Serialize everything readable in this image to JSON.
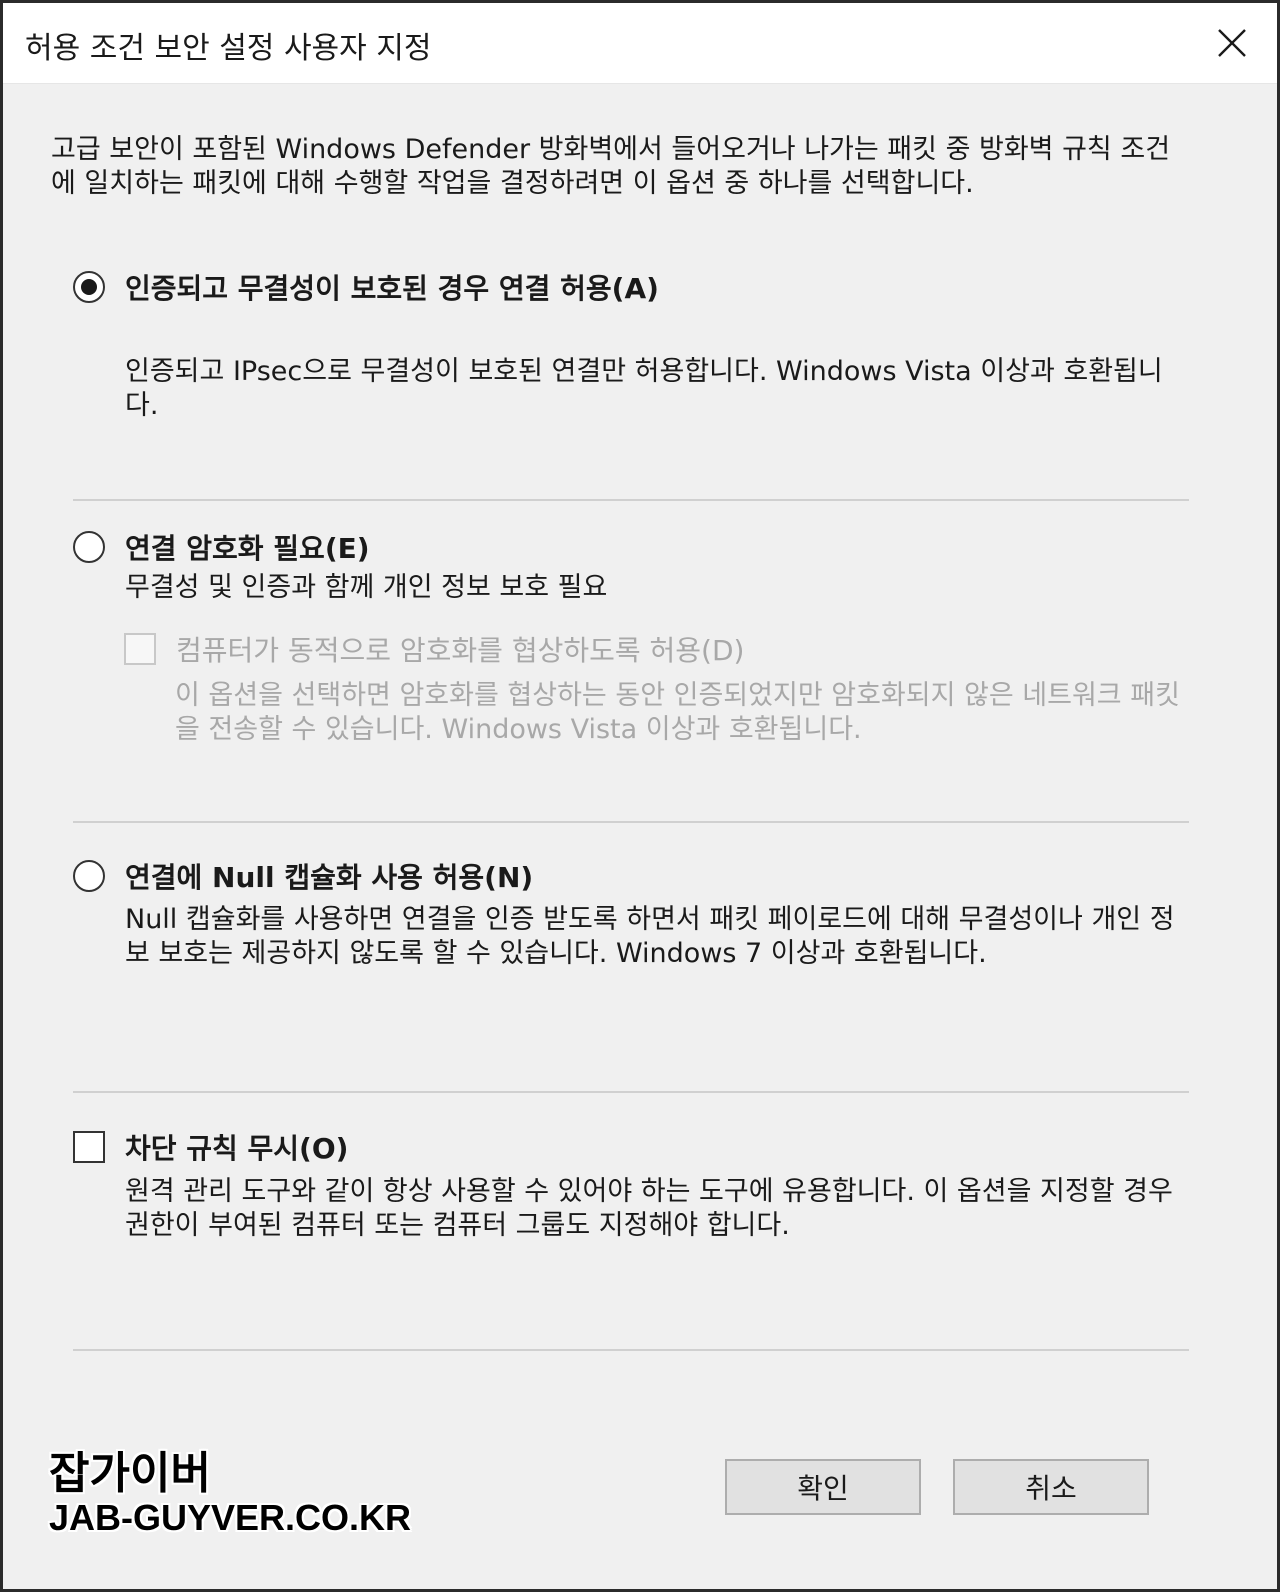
{
  "window": {
    "title": "허용 조건 보안 설정 사용자 지정"
  },
  "intro": "고급 보안이 포함된 Windows Defender 방화벽에서 들어오거나 나가는 패킷 중 방화벽 규칙 조건에 일치하는 패킷에 대해 수행할 작업을 결정하려면 이 옵션 중 하나를 선택합니다.",
  "options": {
    "authenticated": {
      "label": "인증되고 무결성이 보호된 경우 연결 허용(A)",
      "description": "인증되고 IPsec으로 무결성이 보호된 연결만 허용합니다. Windows Vista 이상과 호환됩니다.",
      "selected": true
    },
    "encryption": {
      "label": "연결 암호화 필요(E)",
      "description": "무결성 및 인증과 함께 개인 정보 보호 필요",
      "selected": false,
      "sub": {
        "label": "컴퓨터가 동적으로 암호화를 협상하도록 허용(D)",
        "description": "이 옵션을 선택하면 암호화를 협상하는 동안 인증되었지만 암호화되지 않은 네트워크 패킷을 전송할 수 있습니다. Windows Vista 이상과 호환됩니다.",
        "checked": false,
        "disabled": true
      }
    },
    "null_encap": {
      "label": "연결에 Null 캡슐화 사용 허용(N)",
      "description": "Null 캡슐화를 사용하면 연결을 인증 받도록 하면서 패킷 페이로드에 대해 무결성이나 개인 정보 보호는 제공하지 않도록 할 수 있습니다. Windows 7 이상과 호환됩니다.",
      "selected": false
    },
    "override_block": {
      "label": "차단 규칙 무시(O)",
      "description": "원격 관리 도구와 같이 항상 사용할 수 있어야 하는 도구에 유용합니다. 이 옵션을 지정할 경우 권한이 부여된 컴퓨터 또는 컴퓨터 그룹도 지정해야 합니다.",
      "checked": false
    }
  },
  "buttons": {
    "ok": "확인",
    "cancel": "취소"
  },
  "watermark": {
    "name": "잡가이버",
    "url": "JAB-GUYVER.CO.KR"
  },
  "icons": {
    "close": "close-icon"
  }
}
